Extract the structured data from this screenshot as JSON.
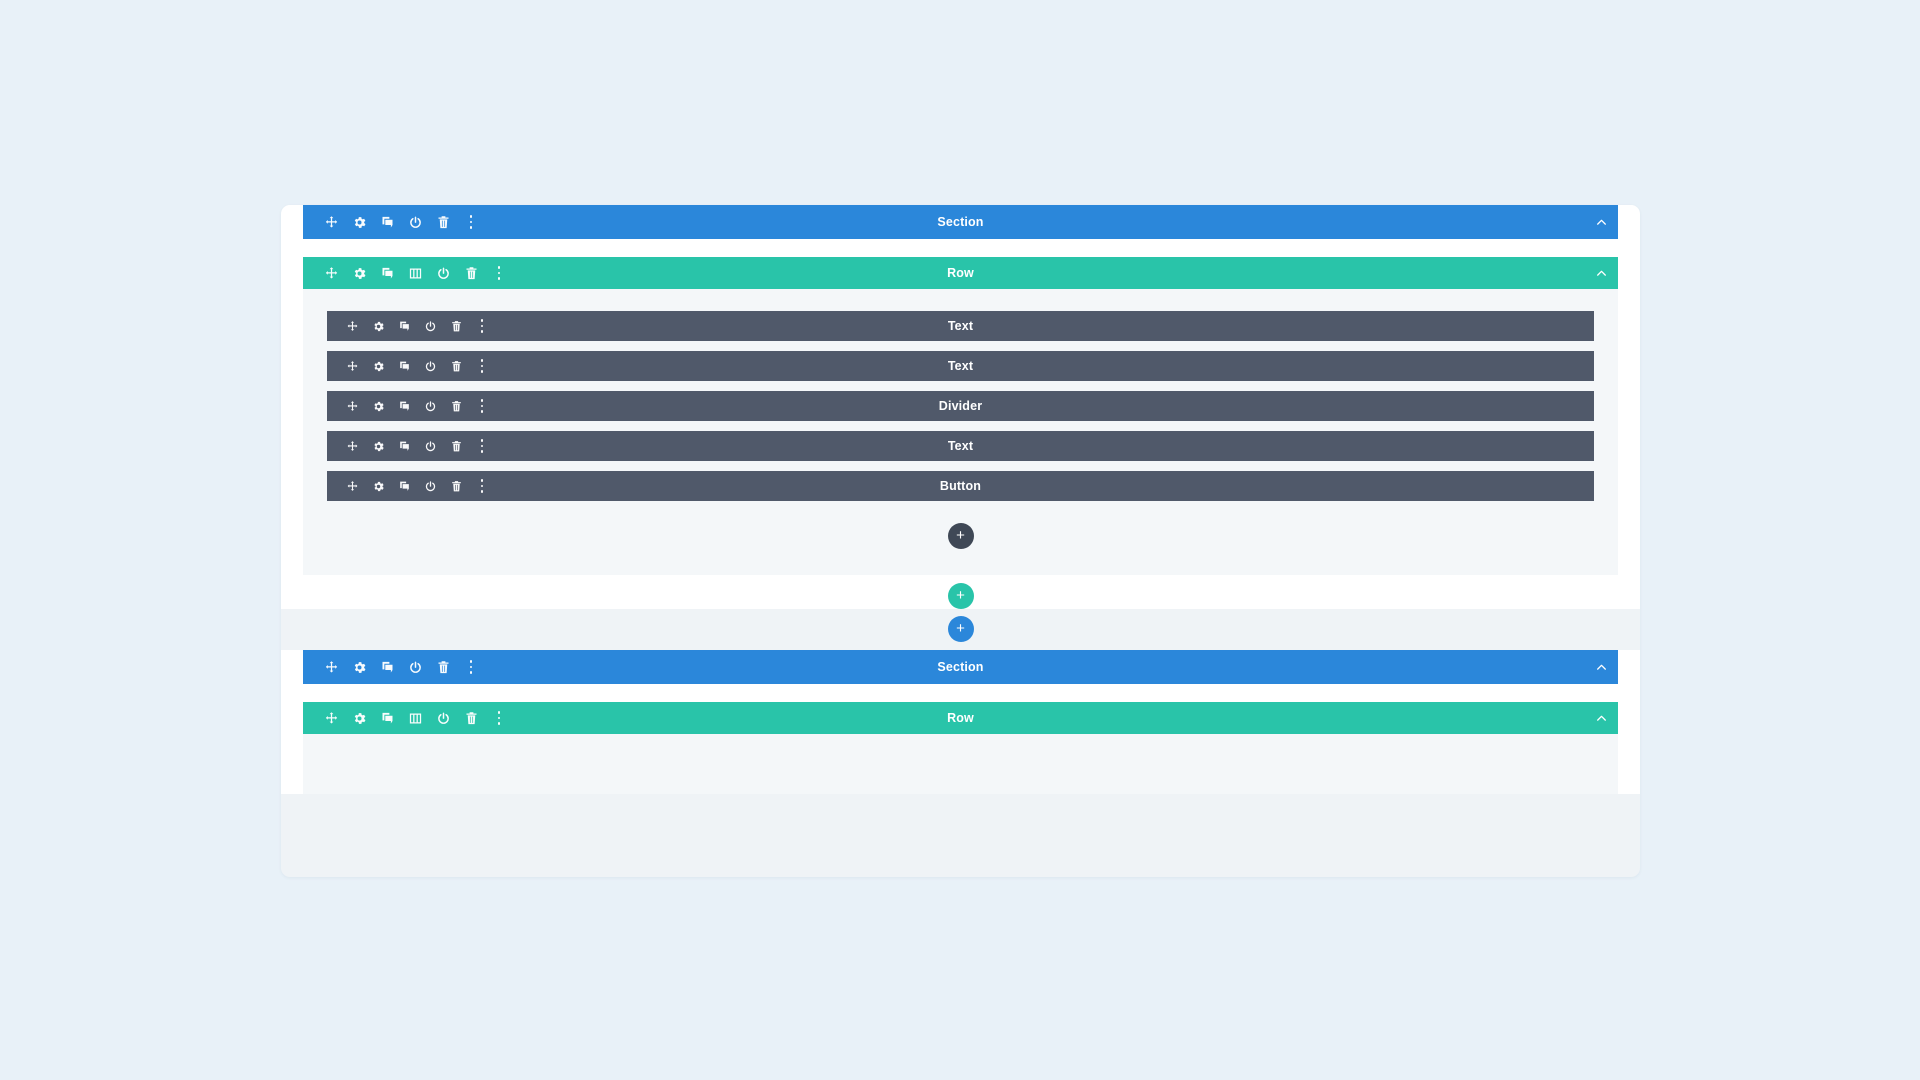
{
  "app": {
    "background_color": "#e8f1f8",
    "canvas_background": "#eff3f6",
    "section_color": "#2b87da",
    "row_color": "#29c4a9",
    "module_color": "#50596a"
  },
  "labels": {
    "section": "Section",
    "row": "Row",
    "text": "Text",
    "divider": "Divider",
    "button": "Button"
  },
  "tools": {
    "move": "move-icon",
    "settings": "gear-icon",
    "duplicate": "duplicate-icon",
    "columns": "columns-icon",
    "disable": "power-icon",
    "delete": "trash-icon",
    "more": "ellipsis-icon",
    "collapse": "chevron-up-icon",
    "add": "plus-icon"
  },
  "add_buttons": {
    "module": {
      "label": "+",
      "name": "add-module-button",
      "color": "#3f4856"
    },
    "row": {
      "label": "+",
      "name": "add-row-button",
      "color": "#29c4a9"
    },
    "section": {
      "label": "+",
      "name": "add-section-button",
      "color": "#2b87da"
    }
  },
  "sections": [
    {
      "title": "Section",
      "rows": [
        {
          "title": "Row",
          "modules": [
            {
              "title": "Text"
            },
            {
              "title": "Text"
            },
            {
              "title": "Divider"
            },
            {
              "title": "Text"
            },
            {
              "title": "Button"
            }
          ]
        }
      ]
    },
    {
      "title": "Section",
      "rows": [
        {
          "title": "Row",
          "modules": []
        }
      ]
    }
  ]
}
